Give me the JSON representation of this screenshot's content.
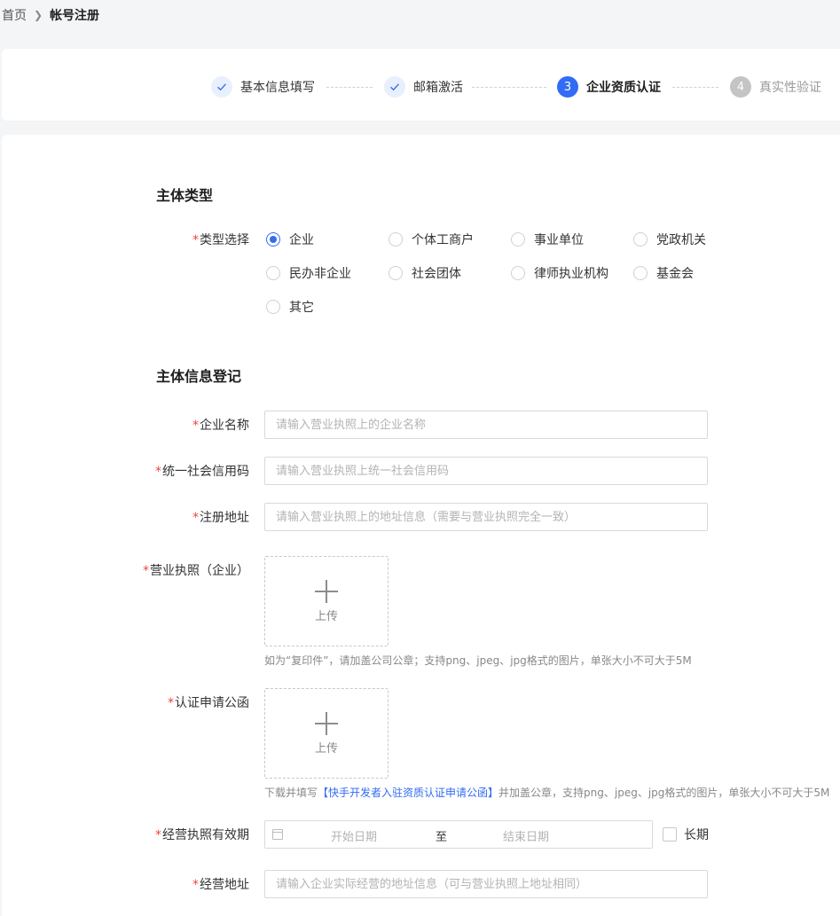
{
  "breadcrumb": {
    "home": "首页",
    "current": "帐号注册"
  },
  "steps": [
    {
      "index": "1",
      "label": "基本信息填写",
      "status": "done"
    },
    {
      "index": "2",
      "label": "邮箱激活",
      "status": "done"
    },
    {
      "index": "3",
      "label": "企业资质认证",
      "status": "active"
    },
    {
      "index": "4",
      "label": "真实性验证",
      "status": "wait"
    }
  ],
  "section1": {
    "title": "主体类型",
    "type_label": "类型选择",
    "required_mark": "*",
    "options": [
      "企业",
      "个体工商户",
      "事业单位",
      "党政机关",
      "民办非企业",
      "社会团体",
      "律师执业机构",
      "基金会",
      "其它"
    ],
    "selected": "企业"
  },
  "section2": {
    "title": "主体信息登记",
    "company_name": {
      "label": "企业名称",
      "placeholder": "请输入营业执照上的企业名称"
    },
    "credit_code": {
      "label": "统一社会信用码",
      "placeholder": "请输入营业执照上统一社会信用码"
    },
    "reg_address": {
      "label": "注册地址",
      "placeholder": "请输入营业执照上的地址信息（需要与营业执照完全一致）"
    },
    "license": {
      "label": "营业执照（企业）",
      "upload_text": "上传",
      "hint": "如为“复印件”，请加盖公司公章；支持png、jpeg、jpg格式的图片，单张大小不可大于5M"
    },
    "auth_letter": {
      "label": "认证申请公函",
      "upload_text": "上传",
      "hint_prefix": "下载并填写",
      "hint_link": "【快手开发者入驻资质认证申请公函】",
      "hint_suffix": "并加盖公章，支持png、jpeg、jpg格式的图片，单张大小不可大于5M"
    },
    "validity": {
      "label": "经营执照有效期",
      "start_placeholder": "开始日期",
      "separator": "至",
      "end_placeholder": "结束日期",
      "long_term_label": "长期"
    },
    "biz_address": {
      "label": "经营地址",
      "placeholder": "请输入企业实际经营的地址信息（可与营业执照上地址相同）"
    }
  },
  "colors": {
    "primary": "#326bf5",
    "required": "#f0453a",
    "background": "#f4f5f7"
  }
}
